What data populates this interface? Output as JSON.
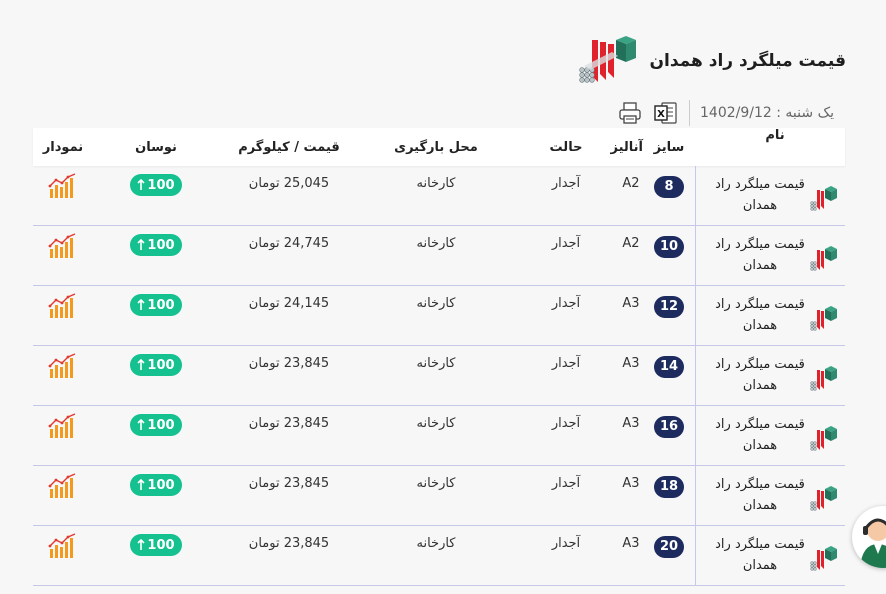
{
  "header": {
    "title": "قیمت میلگرد راد همدان"
  },
  "toolbar": {
    "date": "یک شنبه : 1402/9/12"
  },
  "table": {
    "columns": [
      "نام",
      "سایز",
      "آنالیز",
      "حالت",
      "محل بارگیری",
      "قیمت / کیلوگرم",
      "نوسان",
      "نمودار"
    ],
    "rows": [
      {
        "name": "قیمت میلگرد راد همدان",
        "size": "8",
        "analysis": "A2",
        "state": "آجدار",
        "place": "کارخانه",
        "price": "25,045 تومان",
        "change": "100"
      },
      {
        "name": "قیمت میلگرد راد همدان",
        "size": "10",
        "analysis": "A2",
        "state": "آجدار",
        "place": "کارخانه",
        "price": "24,745 تومان",
        "change": "100"
      },
      {
        "name": "قیمت میلگرد راد همدان",
        "size": "12",
        "analysis": "A3",
        "state": "آجدار",
        "place": "کارخانه",
        "price": "24,145 تومان",
        "change": "100"
      },
      {
        "name": "قیمت میلگرد راد همدان",
        "size": "14",
        "analysis": "A3",
        "state": "آجدار",
        "place": "کارخانه",
        "price": "23,845 تومان",
        "change": "100"
      },
      {
        "name": "قیمت میلگرد راد همدان",
        "size": "16",
        "analysis": "A3",
        "state": "آجدار",
        "place": "کارخانه",
        "price": "23,845 تومان",
        "change": "100"
      },
      {
        "name": "قیمت میلگرد راد همدان",
        "size": "18",
        "analysis": "A3",
        "state": "آجدار",
        "place": "کارخانه",
        "price": "23,845 تومان",
        "change": "100"
      },
      {
        "name": "قیمت میلگرد راد همدان",
        "size": "20",
        "analysis": "A3",
        "state": "آجدار",
        "place": "کارخانه",
        "price": "23,845 تومان",
        "change": "100"
      }
    ]
  },
  "colors": {
    "size_badge": "#1d2b5e",
    "change_badge": "#14c18f",
    "chart_bars": "#f39a1e",
    "chart_line": "#e23a2e",
    "logo_red": "#e0222c",
    "logo_teal": "#2f8a6f",
    "row_border": "#c5c8e6"
  },
  "icons": {
    "print": "printer-icon",
    "excel": "excel-icon",
    "change_arrow": "arrow-up-icon",
    "chart": "bar-chart-icon",
    "logo": "rebar-logo-icon",
    "support": "support-avatar-icon"
  }
}
